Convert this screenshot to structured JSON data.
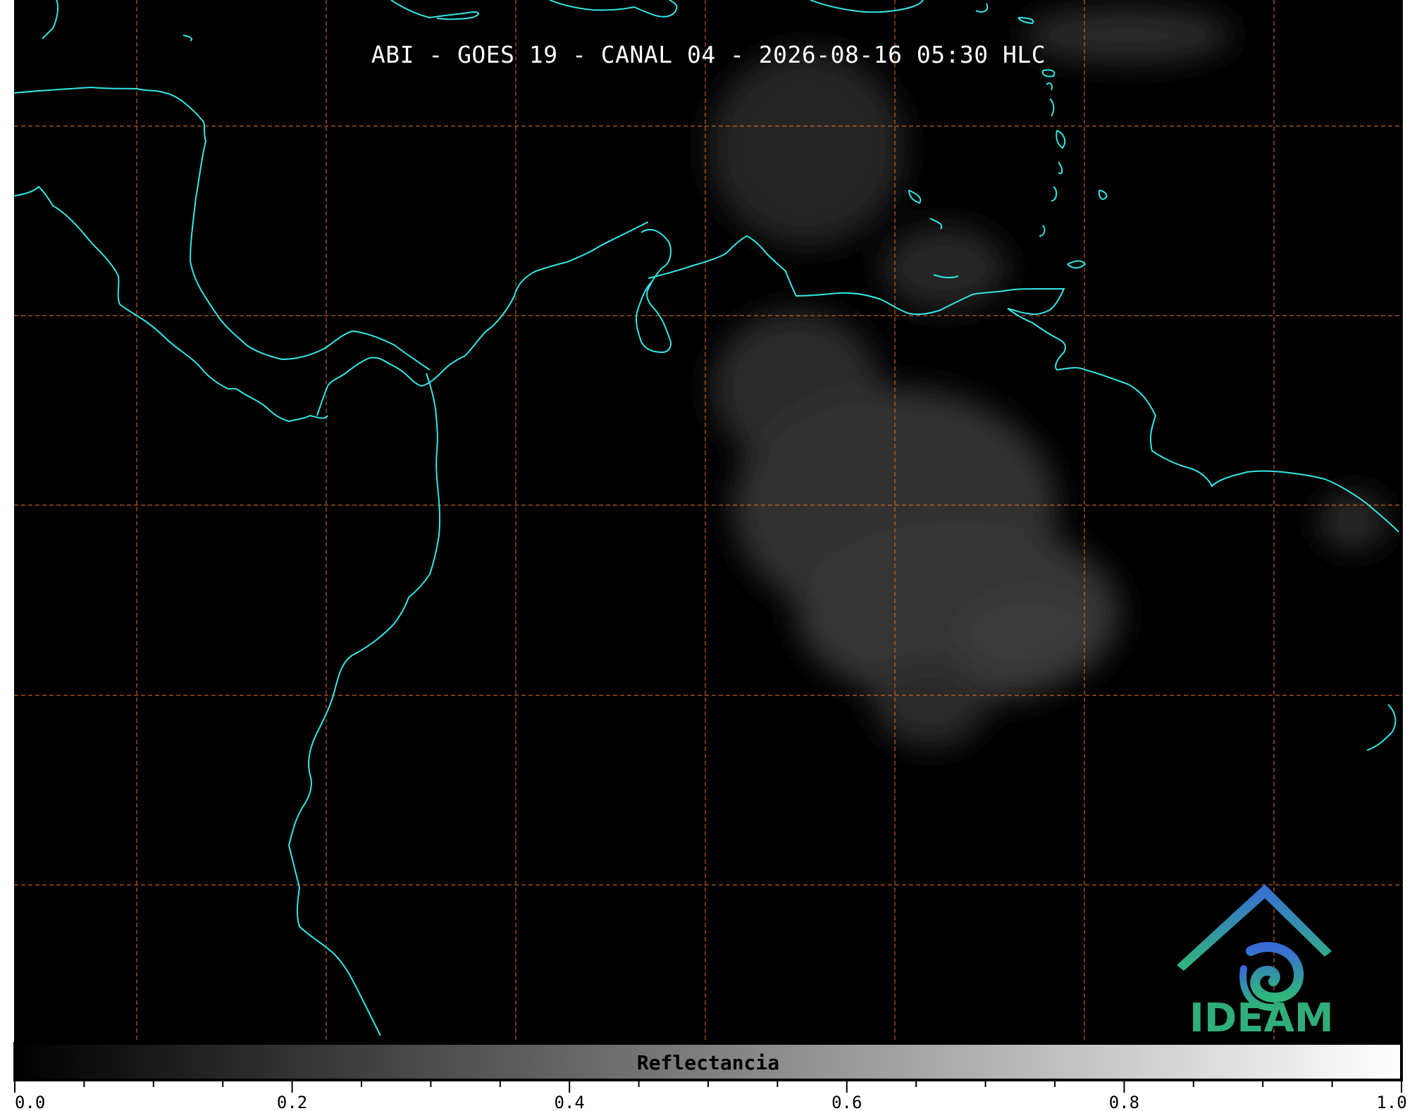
{
  "title": "ABI - GOES 19 - CANAL 04 - 2026-08-16 05:30 HLC",
  "colorbar": {
    "label": "Reflectancia",
    "ticks": [
      "0.0",
      "0.2",
      "0.4",
      "0.6",
      "0.8",
      "1.0"
    ],
    "range": [
      0.0,
      1.0
    ]
  },
  "logo": {
    "text": "IDEAM"
  },
  "map": {
    "coastline_color": "#33e6e6",
    "grid_color": "#e07020",
    "background_color": "#000000"
  }
}
